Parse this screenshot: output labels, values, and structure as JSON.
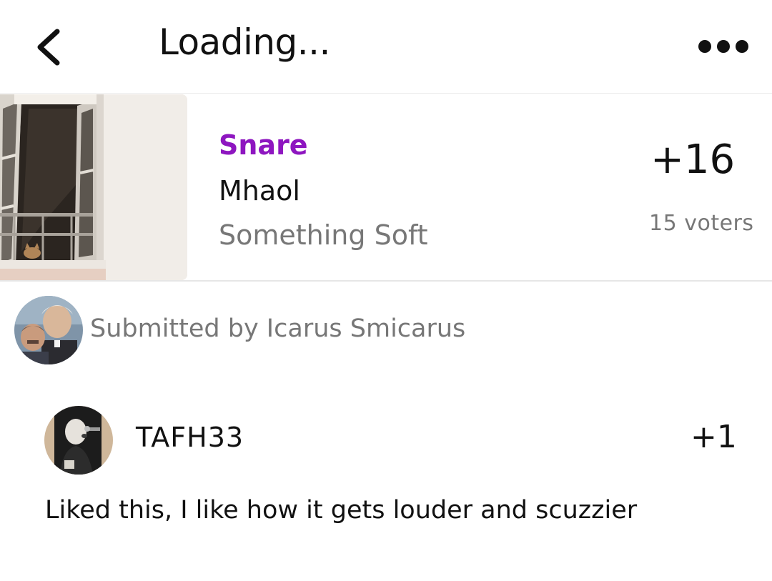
{
  "header": {
    "title": "Loading...",
    "back_icon": "chevron-left-icon",
    "more_icon": "more-horizontal-icon"
  },
  "track": {
    "title": "Snare",
    "artist": "Mhaol",
    "album": "Something Soft",
    "score": "+16",
    "voters": "15 voters",
    "title_color": "#8e16c0"
  },
  "submission": {
    "text": "Submitted by Icarus Smicarus"
  },
  "comments": [
    {
      "username": "TAFH33",
      "score": "+1",
      "body": "Liked this, I like how it gets louder and scuzzier"
    }
  ]
}
